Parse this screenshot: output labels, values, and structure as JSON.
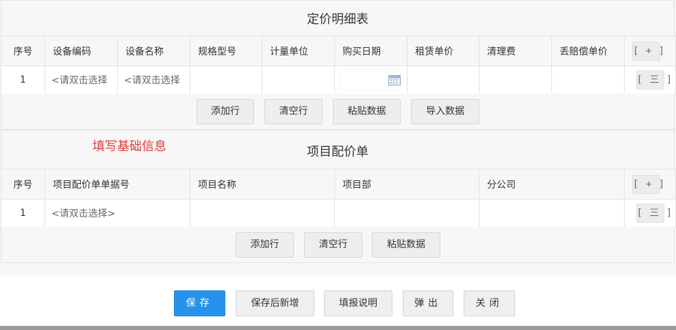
{
  "pricing": {
    "title": "定价明细表",
    "headers": [
      "序号",
      "设备编码",
      "设备名称",
      "规格型号",
      "计量单位",
      "购买日期",
      "租赁单价",
      "清理费",
      "丢赔偿单价"
    ],
    "row": {
      "index": "1",
      "equip_code": "<请双击选择",
      "equip_name": "<请双击选择"
    },
    "add_col_label": "[ + ]",
    "row_menu_label": "[ 三 ]",
    "buttons": [
      "添加行",
      "清空行",
      "粘贴数据",
      "导入数据"
    ]
  },
  "note": "填写基础信息",
  "project": {
    "title": "项目配价单",
    "headers": [
      "序号",
      "项目配价单单据号",
      "项目名称",
      "项目部",
      "分公司"
    ],
    "row": {
      "index": "1",
      "doc_no": "<请双击选择>"
    },
    "add_col_label": "[ + ]",
    "row_menu_label": "[ 三 ]",
    "buttons": [
      "添加行",
      "清空行",
      "粘贴数据"
    ]
  },
  "footer": {
    "save": "保存",
    "save_new": "保存后新增",
    "help": "填报说明",
    "popup": "弹出",
    "close": "关闭"
  },
  "colors": {
    "primary": "#2593ec",
    "note_red": "#e03a3a",
    "border": "#e2e2e2"
  }
}
